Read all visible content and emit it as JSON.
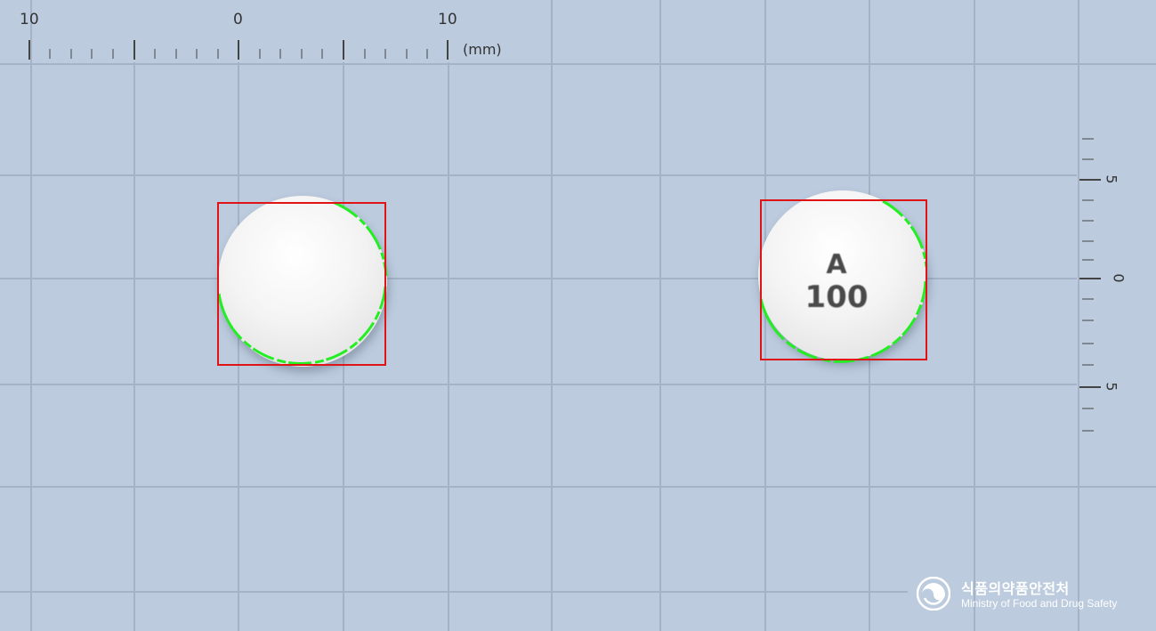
{
  "ruler": {
    "horizontal": {
      "labels": [
        "10",
        "0",
        "10"
      ],
      "unit": "(mm)"
    },
    "vertical": {
      "labels": [
        "5",
        "0",
        "5"
      ]
    }
  },
  "pills": [
    {
      "name": "pill-front",
      "imprint_line1": "",
      "imprint_line2": ""
    },
    {
      "name": "pill-back",
      "imprint_line1": "A",
      "imprint_line2": "100"
    }
  ],
  "colors": {
    "background": "#bccbde",
    "grid": "#a4b3c7",
    "bounding_box": "#e01414",
    "edge_contour": "#22ee22"
  },
  "watermark": {
    "korean": "식품의약품안전처",
    "english": "Ministry of Food and Drug Safety",
    "icon": "mfds-logo-icon"
  }
}
